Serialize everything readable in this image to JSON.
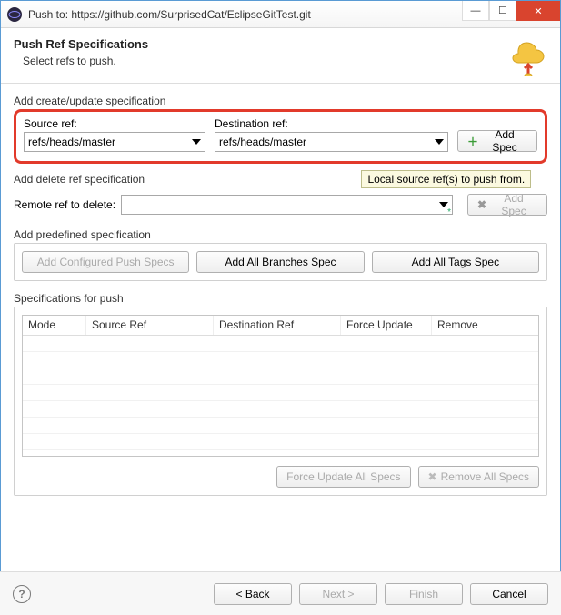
{
  "window": {
    "title": "Push to: https://github.com/SurprisedCat/EclipseGitTest.git"
  },
  "header": {
    "title": "Push Ref Specifications",
    "subtitle": "Select refs to push."
  },
  "createSpec": {
    "groupLabel": "Add create/update specification",
    "sourceLabel": "Source ref:",
    "sourceValue": "refs/heads/master",
    "destLabel": "Destination ref:",
    "destValue": "refs/heads/master",
    "addBtn": "Add Spec",
    "tooltip": "Local source ref(s) to push from."
  },
  "deleteSpec": {
    "groupLabel": "Add delete ref specification",
    "remoteLabel": "Remote ref to delete:",
    "remoteValue": "",
    "addBtn": "Add Spec"
  },
  "predef": {
    "groupLabel": "Add predefined specification",
    "configured": "Add Configured Push Specs",
    "allBranches": "Add All Branches Spec",
    "allTags": "Add All Tags Spec"
  },
  "table": {
    "groupLabel": "Specifications for push",
    "cols": {
      "mode": "Mode",
      "source": "Source Ref",
      "dest": "Destination Ref",
      "force": "Force Update",
      "remove": "Remove"
    }
  },
  "specActions": {
    "forceAll": "Force Update All Specs",
    "removeAll": "Remove All Specs"
  },
  "footer": {
    "back": "< Back",
    "next": "Next >",
    "finish": "Finish",
    "cancel": "Cancel"
  }
}
